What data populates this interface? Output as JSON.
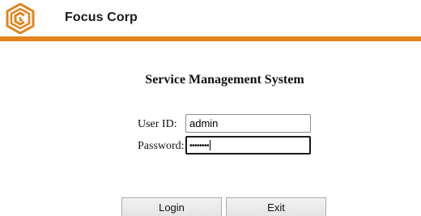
{
  "header": {
    "brand_name": "Focus Corp",
    "logo_icon": "focus-corp-logo-icon",
    "accent_color": "#e2831b"
  },
  "main": {
    "title": "Service Management System"
  },
  "form": {
    "user_id_label": "User ID:",
    "user_id_value": "admin",
    "password_label": "Password:",
    "password_mask": "••••••••"
  },
  "buttons": {
    "login_label": "Login",
    "exit_label": "Exit"
  }
}
